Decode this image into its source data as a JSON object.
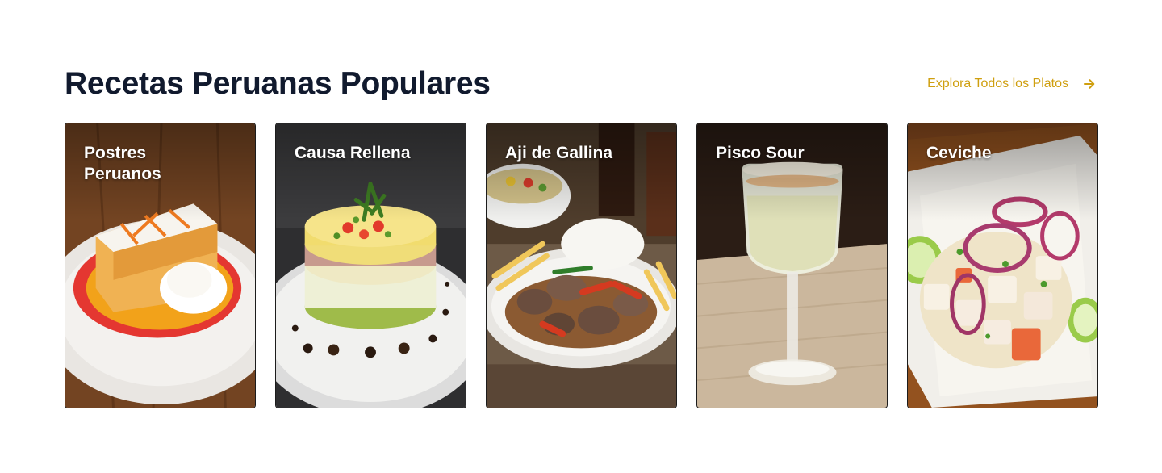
{
  "section": {
    "title": "Recetas Peruanas Populares",
    "explore_link": {
      "label": "Explora Todos los Platos",
      "icon": "arrow-right-icon"
    }
  },
  "colors": {
    "heading": "#111a2e",
    "accent": "#cf9f0f",
    "card_text": "#ffffff"
  },
  "cards": [
    {
      "title": "Postres Peruanos"
    },
    {
      "title": "Causa Rellena"
    },
    {
      "title": "Aji de Gallina"
    },
    {
      "title": "Pisco Sour"
    },
    {
      "title": "Ceviche"
    }
  ]
}
